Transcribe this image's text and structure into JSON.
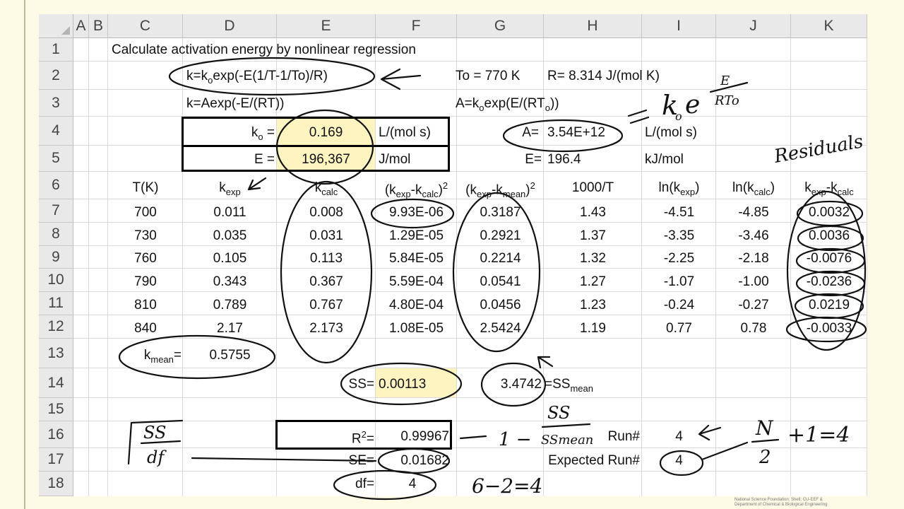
{
  "columns": [
    "A",
    "B",
    "C",
    "D",
    "E",
    "F",
    "G",
    "H",
    "I",
    "J",
    "K"
  ],
  "rows": [
    "1",
    "2",
    "3",
    "4",
    "5",
    "6",
    "7",
    "8",
    "9",
    "10",
    "11",
    "12",
    "13",
    "14",
    "15",
    "16",
    "17",
    "18"
  ],
  "title": "Calculate activation energy by nonlinear regression",
  "eq1": "k=k",
  "eq1_sub": "o",
  "eq1_rest": "exp(-E(1/T-1/To)/R)",
  "eq2": "k=Aexp(-E/(RT))",
  "to_label": "To = 770 K",
  "r_label": "R= 8.314 J/(mol K)",
  "a_eq": "A=k",
  "a_eq_sub": "o",
  "a_eq_mid": "exp(E/(RT",
  "a_eq_sub2": "o",
  "a_eq_end": "))",
  "params": {
    "ko_label_main": "k",
    "ko_label_sub": "o",
    "ko_label_eq": " =",
    "ko_value": "0.169",
    "ko_unit": "L/(mol s)",
    "e_label": "E =",
    "e_value": "196,367",
    "e_unit": "J/mol",
    "a_label": "A=",
    "a_value": "3.54E+12",
    "a_unit": "L/(mol s)",
    "e2_label": "E=",
    "e2_value": "196.4",
    "e2_unit": "kJ/mol"
  },
  "headers": {
    "t": "T(K)",
    "kexp_main": "k",
    "kexp_sub": "exp",
    "kcalc_main": "k",
    "kcalc_sub": "calc",
    "f_open": "(k",
    "f_sub1": "exp",
    "f_mid": "-k",
    "f_sub2": "calc",
    "f_close": ")",
    "f_sup": "2",
    "g_open": "(k",
    "g_sub1": "exp",
    "g_mid": "-k",
    "g_sub2": "mean",
    "g_close": ")",
    "g_sup": "2",
    "h": "1000/T",
    "i_open": "ln(k",
    "i_sub": "exp",
    "i_close": ")",
    "j_open": "ln(k",
    "j_sub": "calc",
    "j_close": ")",
    "k_main": "k",
    "k_sub1": "exp",
    "k_mid": "-k",
    "k_sub2": "calc"
  },
  "data_rows": [
    {
      "t": "700",
      "kexp": "0.011",
      "kcalc": "0.008",
      "f": "9.93E-06",
      "g": "0.3187",
      "h": "1.43",
      "i": "-4.51",
      "j": "-4.85",
      "k": "0.0032"
    },
    {
      "t": "730",
      "kexp": "0.035",
      "kcalc": "0.031",
      "f": "1.29E-05",
      "g": "0.2921",
      "h": "1.37",
      "i": "-3.35",
      "j": "-3.46",
      "k": "0.0036"
    },
    {
      "t": "760",
      "kexp": "0.105",
      "kcalc": "0.113",
      "f": "5.84E-05",
      "g": "0.2214",
      "h": "1.32",
      "i": "-2.25",
      "j": "-2.18",
      "k": "-0.0076"
    },
    {
      "t": "790",
      "kexp": "0.343",
      "kcalc": "0.367",
      "f": "5.59E-04",
      "g": "0.0541",
      "h": "1.27",
      "i": "-1.07",
      "j": "-1.00",
      "k": "-0.0236"
    },
    {
      "t": "810",
      "kexp": "0.789",
      "kcalc": "0.767",
      "f": "4.80E-04",
      "g": "0.0456",
      "h": "1.23",
      "i": "-0.24",
      "j": "-0.27",
      "k": "0.0219"
    },
    {
      "t": "840",
      "kexp": "2.17",
      "kcalc": "2.173",
      "f": "1.08E-05",
      "g": "2.5424",
      "h": "1.19",
      "i": "0.77",
      "j": "0.78",
      "k": "-0.0033"
    }
  ],
  "kmean_main": "k",
  "kmean_sub": "mean",
  "kmean_eq": "=",
  "kmean_value": "0.5755",
  "ss_label": "SS=",
  "ss_value": "0.00113",
  "ssmean_value": "3.4742",
  "ssmean_label": "=SS",
  "ssmean_sub": "mean",
  "r2_label_main": "R",
  "r2_label_sup": "2",
  "r2_label_eq": "=",
  "r2_value": "0.99967",
  "se_label": "SE=",
  "se_value": "0.01682",
  "df_label": "df=",
  "df_value": "4",
  "run_label": "Run#",
  "run_value": "4",
  "exp_run_label": "Expected Run#",
  "exp_run_value": "4",
  "ann_residuals": "Residuals",
  "ann_ko": "k",
  "ann_ko_sub": "o",
  "ann_e": "e",
  "ann_frac_top": "E",
  "ann_frac_bot": "RTo",
  "ann_eq_sign": "=",
  "ann_one_minus": "1 −",
  "ann_ss": "SS",
  "ann_ssmean": "SSmean",
  "ann_n": "N",
  "ann_two": "2",
  "ann_plus1": "+1=4",
  "ann_df_calc": "6−2=4",
  "ann_sqrt_ss": "SS",
  "ann_sqrt_df": "df",
  "credit_line1": "National Science Foundation; Shell; CU-EEF &",
  "credit_line2": "Department of Chemical & Biological Engineering"
}
